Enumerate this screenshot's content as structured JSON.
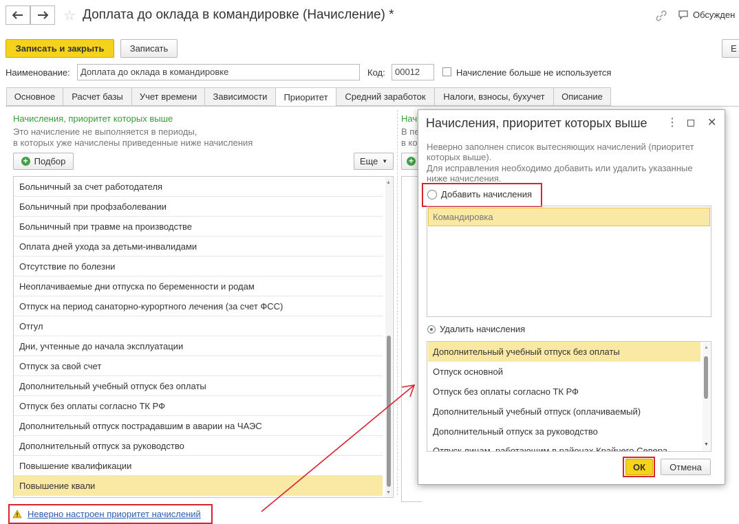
{
  "window": {
    "title": "Доплата до оклада в командировке (Начисление) *",
    "discussions_label": "Обсужден",
    "more_label_right": "Е"
  },
  "toolbar": {
    "save_close_label": "Записать и закрыть",
    "save_label": "Записать"
  },
  "form": {
    "name_label": "Наименование:",
    "name_value": "Доплата до оклада в командировке",
    "code_label": "Код:",
    "code_value": "00012",
    "not_used_label": "Начисление больше не используется"
  },
  "tabs": [
    {
      "label": "Основное"
    },
    {
      "label": "Расчет базы"
    },
    {
      "label": "Учет времени"
    },
    {
      "label": "Зависимости"
    },
    {
      "label": "Приоритет"
    },
    {
      "label": "Средний заработок"
    },
    {
      "label": "Налоги, взносы, бухучет"
    },
    {
      "label": "Описание"
    }
  ],
  "left_panel": {
    "heading": "Начисления, приоритет которых выше",
    "desc_line1": "Это начисление не выполняется в периоды,",
    "desc_line2": "в которых уже начислены приведенные ниже начисления",
    "pick_label": "Подбор",
    "more_label": "Еще",
    "items": [
      "Больничный за счет работодателя",
      "Больничный при профзаболевании",
      "Больничный при травме на производстве",
      "Оплата дней ухода за детьми-инвалидами",
      "Отсутствие по болезни",
      "Неоплачиваемые дни отпуска по беременности и родам",
      "Отпуск на период санаторно-курортного лечения (за счет ФСС)",
      "Отгул",
      "Дни, учтенные до начала эксплуатации",
      "Отпуск за свой счет",
      "Дополнительный учебный отпуск без оплаты",
      "Отпуск без оплаты согласно ТК РФ",
      "Дополнительный отпуск пострадавшим в аварии на ЧАЭС",
      "Дополнительный отпуск за руководство",
      "Повышение квалификации",
      "Повышение квали"
    ],
    "warning_text": "Неверно настроен приоритет начислений"
  },
  "right_panel_partial": {
    "heading": "Нач",
    "line1": "В пе",
    "line2": "в ко"
  },
  "dialog": {
    "title": "Начисления, приоритет которых выше",
    "message_line1": "Неверно заполнен список вытесняющих начислений (приоритет",
    "message_line2": "которых выше).",
    "message_line3": "Для исправления необходимо добавить или удалить указанные",
    "message_line4": "ниже начисления.",
    "add_label": "Добавить начисления",
    "add_items": [
      "Командировка"
    ],
    "remove_label": "Удалить начисления",
    "remove_items": [
      "Дополнительный учебный отпуск без оплаты",
      "Отпуск основной",
      "Отпуск без оплаты согласно ТК РФ",
      "Дополнительный учебный отпуск (оплачиваемый)",
      "Дополнительный отпуск за руководство",
      "Отпуск лицам, работающим в районах Крайнего Севера"
    ],
    "ok_label": "ОК",
    "cancel_label": "Отмена"
  },
  "colors": {
    "accent_yellow": "#f5d21c",
    "selection": "#fae8a5",
    "annotation_red": "#d8222f",
    "green_text": "#3a9a3a"
  }
}
